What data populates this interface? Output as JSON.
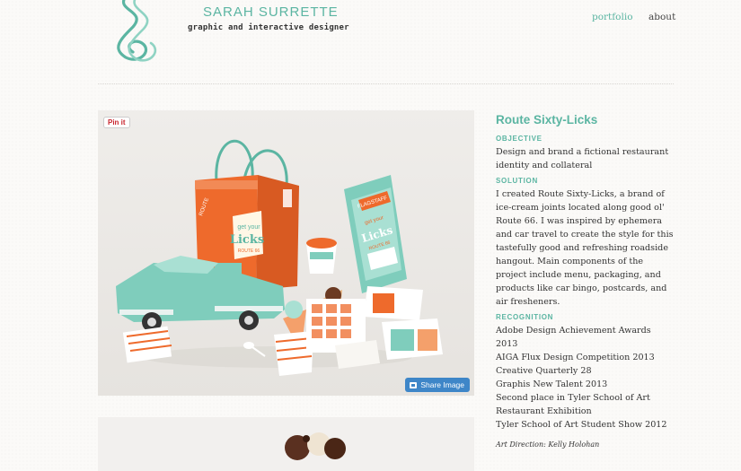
{
  "header": {
    "name": "SARAH SURRETTE",
    "tagline": "graphic and interactive designer",
    "nav": [
      {
        "label": "portfolio",
        "active": true
      },
      {
        "label": "about",
        "active": false
      }
    ]
  },
  "hero": {
    "pin_label": "Pin it",
    "share_label": "Share Image",
    "print": {
      "bag_slogan": "get your",
      "bag_main": "Licks",
      "bag_route": "ROUTE 66",
      "sign": "ROUTE",
      "menu_top": "FLAGSTAFF",
      "menu_slogan": "get your",
      "menu_main": "Licks",
      "menu_route": "ROUTE 66"
    }
  },
  "project": {
    "title": "Route Sixty-Licks",
    "objective_label": "OBJECTIVE",
    "objective": "Design and brand a fictional restaurant identity and collateral",
    "solution_label": "SOLUTION",
    "solution": "I created Route Sixty-Licks, a brand of ice-cream joints located along good ol' Route 66. I was inspired by ephemera and car travel to create the style for this tastefully good and refreshing roadside hangout. Main components of the project include menu, packaging, and products like car bingo, postcards, and air fresheners.",
    "recognition_label": "RECOGNITION",
    "recognition": [
      "Adobe Design Achievement Awards 2013",
      "AIGA Flux Design Competition 2013",
      "Creative Quarterly 28",
      "Graphis New Talent 2013",
      "Second place in Tyler School of Art Restaurant Exhibition",
      "Tyler School of Art Student Show 2012"
    ],
    "credit": "Art Direction: Kelly Holohan"
  },
  "colors": {
    "accent": "#5bb5a2",
    "orange": "#ee6a2c",
    "mint": "#7fcdbc",
    "share_blue": "#3e86c8"
  }
}
